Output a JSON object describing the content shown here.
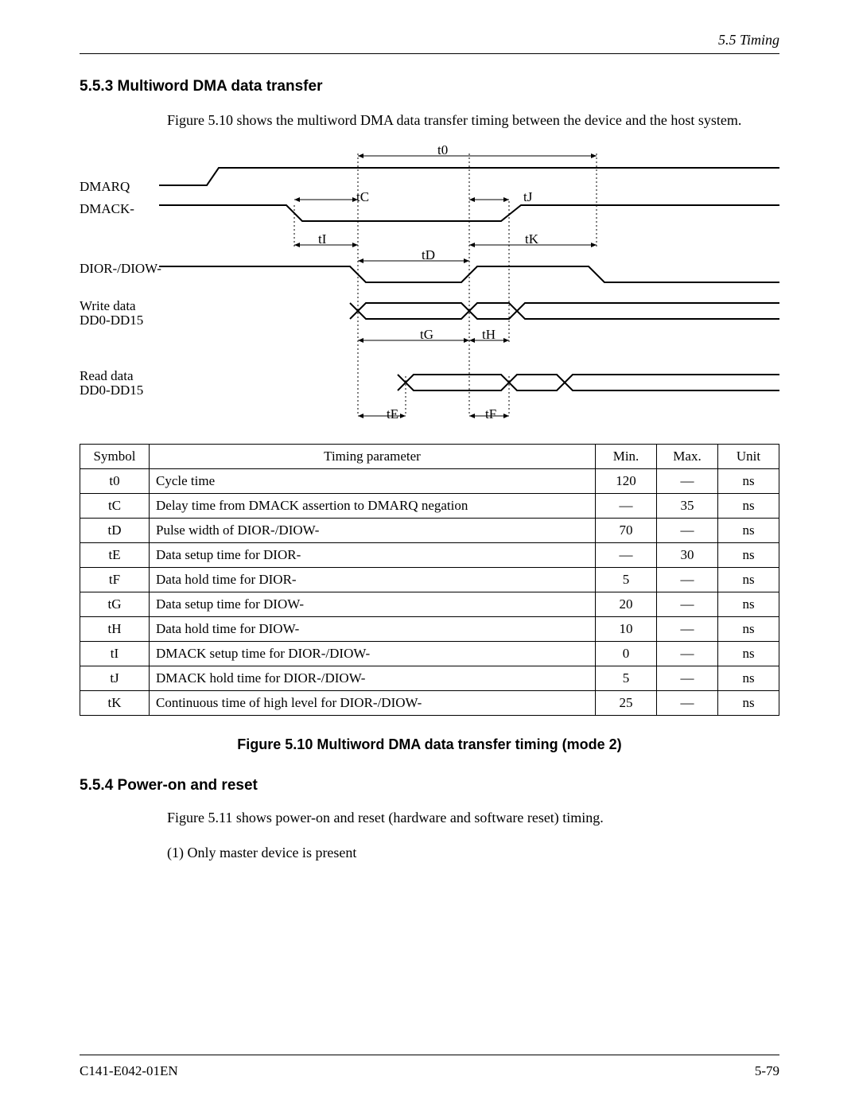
{
  "header": {
    "section_label": "5.5  Timing"
  },
  "section_553": {
    "heading": "5.5.3  Multiword DMA data transfer",
    "para": "Figure 5.10 shows the multiword DMA data transfer timing between the device and the host system."
  },
  "diagram": {
    "signals": {
      "dmarq": "DMARQ",
      "dmack": "DMACK-",
      "dior_diow": "DIOR-/DIOW-",
      "write_data_1": "Write data",
      "write_data_2": "DD0-DD15",
      "read_data_1": "Read data",
      "read_data_2": "DD0-DD15"
    },
    "tlabels": {
      "t0": "t0",
      "tC": "tC",
      "tJ": "tJ",
      "tI": "tI",
      "tK": "tK",
      "tD": "tD",
      "tG": "tG",
      "tH": "tH",
      "tE": "tE",
      "tF": "tF"
    }
  },
  "table": {
    "headers": {
      "symbol": "Symbol",
      "param": "Timing parameter",
      "min": "Min.",
      "max": "Max.",
      "unit": "Unit"
    },
    "rows": [
      {
        "symbol": "t0",
        "param": "Cycle time",
        "min": "120",
        "max": "—",
        "unit": "ns"
      },
      {
        "symbol": "tC",
        "param": "Delay time from DMACK assertion to DMARQ negation",
        "min": "—",
        "max": "35",
        "unit": "ns"
      },
      {
        "symbol": "tD",
        "param": "Pulse width of DIOR-/DIOW-",
        "min": "70",
        "max": "—",
        "unit": "ns"
      },
      {
        "symbol": "tE",
        "param": "Data setup time for DIOR-",
        "min": "—",
        "max": "30",
        "unit": "ns"
      },
      {
        "symbol": "tF",
        "param": "Data hold time for DIOR-",
        "min": "5",
        "max": "—",
        "unit": "ns"
      },
      {
        "symbol": "tG",
        "param": "Data setup time for DIOW-",
        "min": "20",
        "max": "—",
        "unit": "ns"
      },
      {
        "symbol": "tH",
        "param": "Data hold time for DIOW-",
        "min": "10",
        "max": "—",
        "unit": "ns"
      },
      {
        "symbol": "tI",
        "param": "DMACK setup time for DIOR-/DIOW-",
        "min": "0",
        "max": "—",
        "unit": "ns"
      },
      {
        "symbol": "tJ",
        "param": "DMACK hold time for DIOR-/DIOW-",
        "min": "5",
        "max": "—",
        "unit": "ns"
      },
      {
        "symbol": "tK",
        "param": "Continuous time of high level for DIOR-/DIOW-",
        "min": "25",
        "max": "—",
        "unit": "ns"
      }
    ]
  },
  "figure_caption": "Figure 5.10      Multiword DMA data transfer timing (mode 2)",
  "section_554": {
    "heading": "5.5.4  Power-on and reset",
    "para": "Figure 5.11 shows power-on and reset (hardware and software reset) timing.",
    "item1": "(1)  Only master device is present"
  },
  "footer": {
    "doc_id": "C141-E042-01EN",
    "page_num": "5-79"
  }
}
